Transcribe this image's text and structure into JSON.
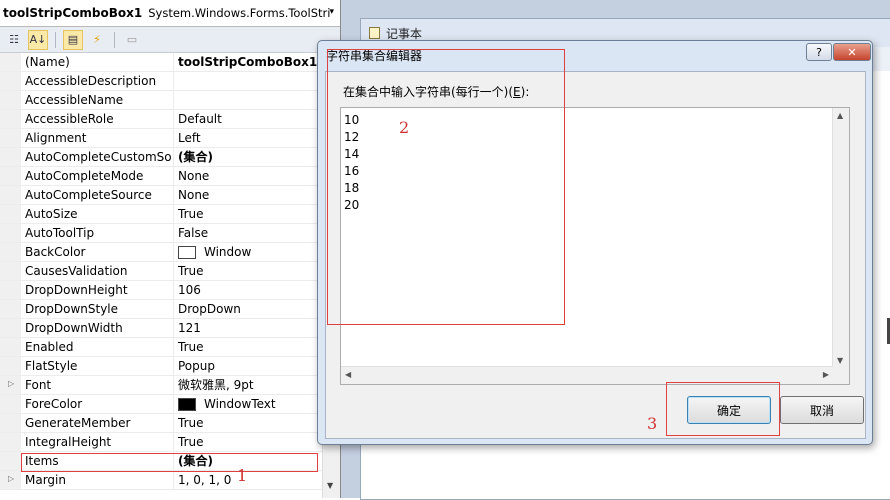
{
  "object_selector": {
    "name": "toolStripComboBox1",
    "type": "System.Windows.Forms.ToolStri",
    "arrow": "▾"
  },
  "toolbar": {
    "categorized_icon": "categorized-icon",
    "alphabetical_icon": "alphabetical-icon",
    "properties_icon": "properties-icon",
    "events_icon": "lightning-icon",
    "pages_icon": "property-pages-icon"
  },
  "properties": [
    {
      "name": "(Name)",
      "value": "toolStripComboBox1",
      "bold": true
    },
    {
      "name": "AccessibleDescription",
      "value": ""
    },
    {
      "name": "AccessibleName",
      "value": ""
    },
    {
      "name": "AccessibleRole",
      "value": "Default"
    },
    {
      "name": "Alignment",
      "value": "Left"
    },
    {
      "name": "AutoCompleteCustomSo",
      "value": "(集合)",
      "bold": true
    },
    {
      "name": "AutoCompleteMode",
      "value": "None"
    },
    {
      "name": "AutoCompleteSource",
      "value": "None"
    },
    {
      "name": "AutoSize",
      "value": "True"
    },
    {
      "name": "AutoToolTip",
      "value": "False"
    },
    {
      "name": "BackColor",
      "value": "Window",
      "swatch": "#ffffff"
    },
    {
      "name": "CausesValidation",
      "value": "True"
    },
    {
      "name": "DropDownHeight",
      "value": "106"
    },
    {
      "name": "DropDownStyle",
      "value": "DropDown"
    },
    {
      "name": "DropDownWidth",
      "value": "121"
    },
    {
      "name": "Enabled",
      "value": "True"
    },
    {
      "name": "FlatStyle",
      "value": "Popup"
    },
    {
      "name": "Font",
      "value": "微软雅黑, 9pt",
      "expandable": true
    },
    {
      "name": "ForeColor",
      "value": "WindowText",
      "swatch": "#000000"
    },
    {
      "name": "GenerateMember",
      "value": "True"
    },
    {
      "name": "IntegralHeight",
      "value": "True"
    },
    {
      "name": "Items",
      "value": "(集合)",
      "bold": true
    },
    {
      "name": "Margin",
      "value": "1, 0, 1, 0",
      "expandable": true
    }
  ],
  "annotations": {
    "one": "1",
    "two": "2",
    "three": "3"
  },
  "notepad": {
    "title": "记事本"
  },
  "dialog": {
    "title": "字符串集合编辑器",
    "help_label": "?",
    "close_label": "✕",
    "prompt_text": "在集合中输入字符串(每行一个)(",
    "prompt_key": "E",
    "prompt_end": "):",
    "lines": [
      "10",
      "12",
      "14",
      "16",
      "18",
      "20"
    ],
    "ok_label": "确定",
    "cancel_label": "取消"
  },
  "colors": {
    "annotation_red": "#e04040",
    "title_bg": "#dbe6f4",
    "close_red": "#c4442c"
  }
}
